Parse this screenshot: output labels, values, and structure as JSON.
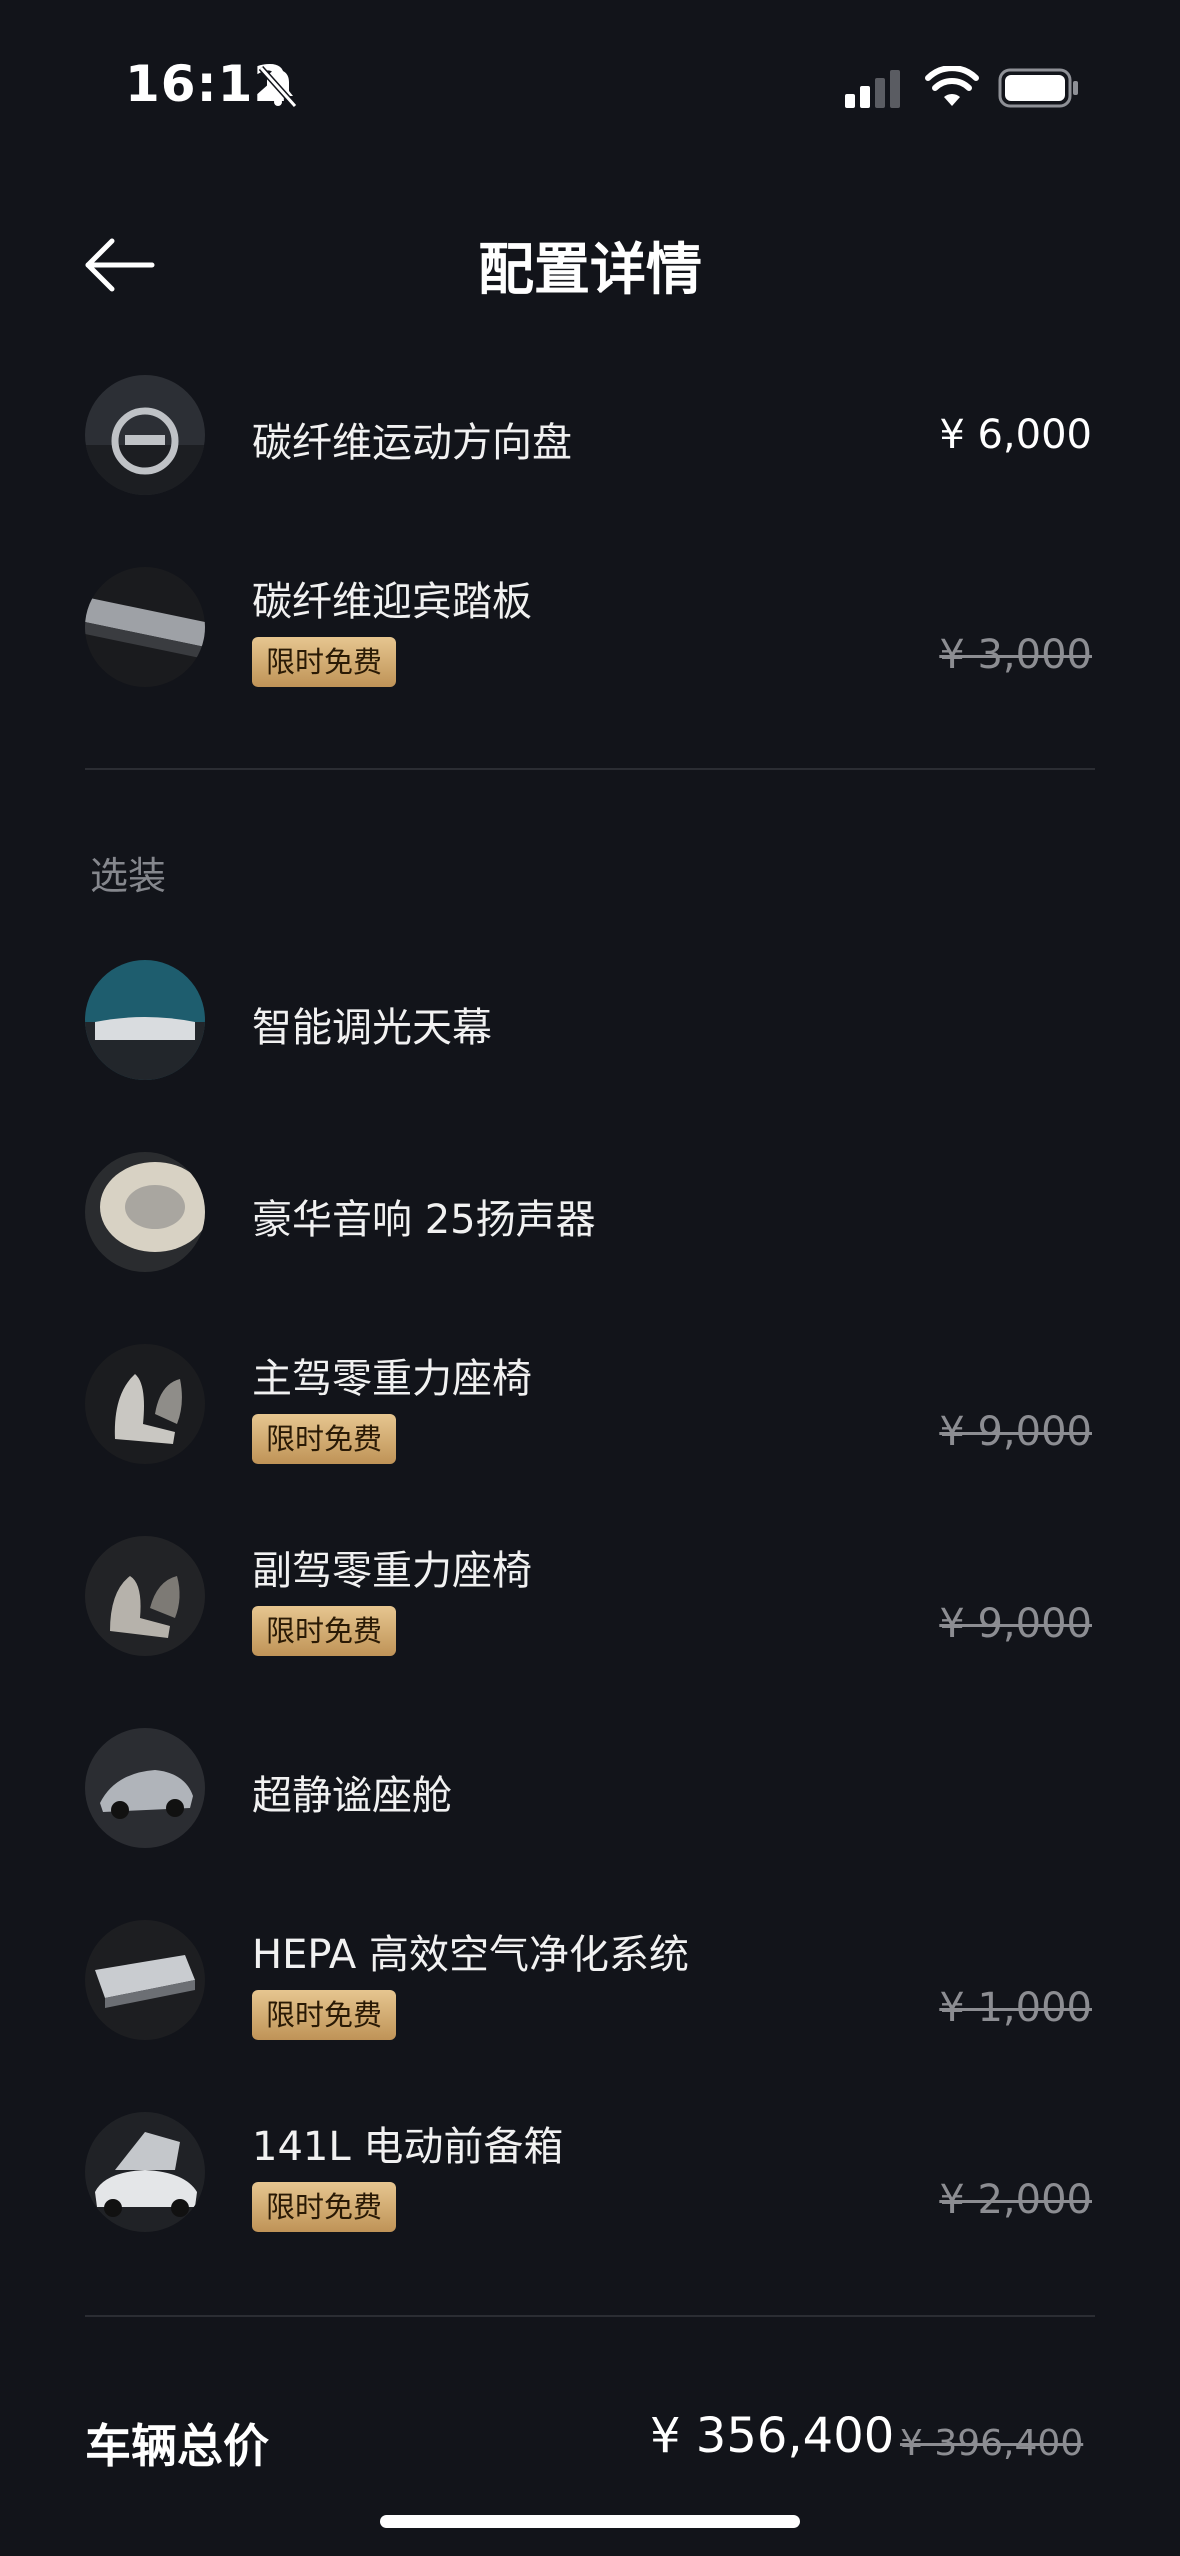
{
  "status_bar": {
    "time": "16:12"
  },
  "nav": {
    "title": "配置详情"
  },
  "top_items": [
    {
      "name": "碳纤维运动方向盘",
      "price": "¥ 6,000"
    },
    {
      "name": "碳纤维迎宾踏板",
      "badge": "限时免费",
      "old_price": "¥ 3,000"
    }
  ],
  "section_title": "选装",
  "optional_items": [
    {
      "name": "智能调光天幕"
    },
    {
      "name": "豪华音响 25扬声器"
    },
    {
      "name": "主驾零重力座椅",
      "badge": "限时免费",
      "old_price": "¥ 9,000"
    },
    {
      "name": "副驾零重力座椅",
      "badge": "限时免费",
      "old_price": "¥ 9,000"
    },
    {
      "name": "超静谧座舱"
    },
    {
      "name": "HEPA 高效空气净化系统",
      "badge": "限时免费",
      "old_price": "¥ 1,000"
    },
    {
      "name": "141L 电动前备箱",
      "badge": "限时免费",
      "old_price": "¥ 2,000"
    }
  ],
  "total": {
    "label": "车辆总价",
    "price": "¥ 356,400",
    "old_price": "¥ 396,400"
  },
  "colors": {
    "background": "#12141a",
    "badge_gold": "#d4ac72",
    "muted": "#8c8d92"
  }
}
